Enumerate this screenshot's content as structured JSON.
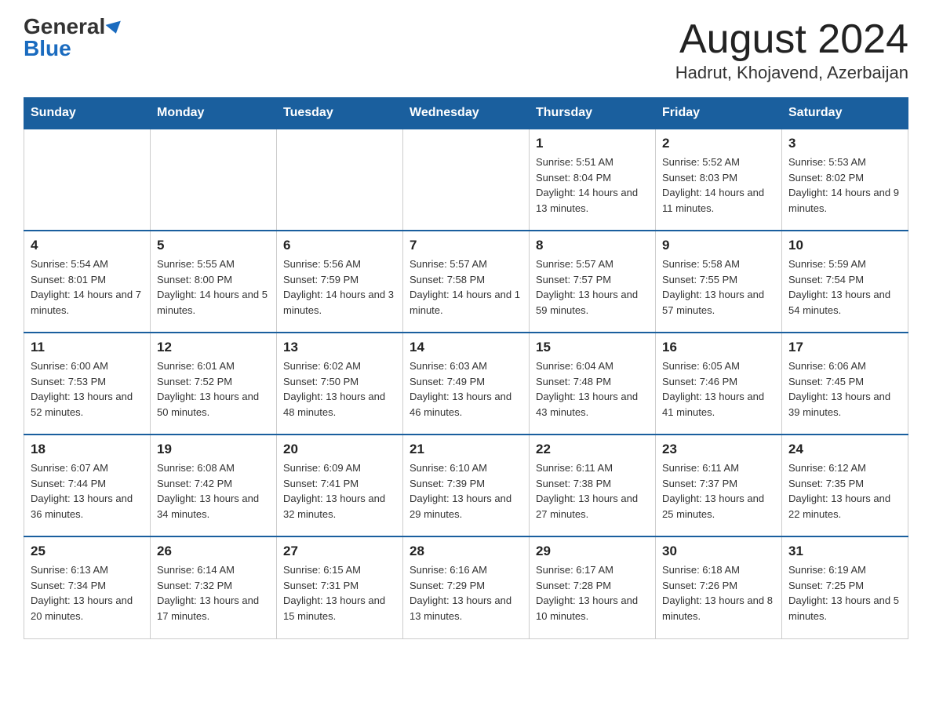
{
  "logo": {
    "general": "General",
    "blue": "Blue"
  },
  "header": {
    "month_year": "August 2024",
    "location": "Hadrut, Khojavend, Azerbaijan"
  },
  "days_of_week": [
    "Sunday",
    "Monday",
    "Tuesday",
    "Wednesday",
    "Thursday",
    "Friday",
    "Saturday"
  ],
  "weeks": [
    [
      {
        "day": "",
        "info": ""
      },
      {
        "day": "",
        "info": ""
      },
      {
        "day": "",
        "info": ""
      },
      {
        "day": "",
        "info": ""
      },
      {
        "day": "1",
        "info": "Sunrise: 5:51 AM\nSunset: 8:04 PM\nDaylight: 14 hours and 13 minutes."
      },
      {
        "day": "2",
        "info": "Sunrise: 5:52 AM\nSunset: 8:03 PM\nDaylight: 14 hours and 11 minutes."
      },
      {
        "day": "3",
        "info": "Sunrise: 5:53 AM\nSunset: 8:02 PM\nDaylight: 14 hours and 9 minutes."
      }
    ],
    [
      {
        "day": "4",
        "info": "Sunrise: 5:54 AM\nSunset: 8:01 PM\nDaylight: 14 hours and 7 minutes."
      },
      {
        "day": "5",
        "info": "Sunrise: 5:55 AM\nSunset: 8:00 PM\nDaylight: 14 hours and 5 minutes."
      },
      {
        "day": "6",
        "info": "Sunrise: 5:56 AM\nSunset: 7:59 PM\nDaylight: 14 hours and 3 minutes."
      },
      {
        "day": "7",
        "info": "Sunrise: 5:57 AM\nSunset: 7:58 PM\nDaylight: 14 hours and 1 minute."
      },
      {
        "day": "8",
        "info": "Sunrise: 5:57 AM\nSunset: 7:57 PM\nDaylight: 13 hours and 59 minutes."
      },
      {
        "day": "9",
        "info": "Sunrise: 5:58 AM\nSunset: 7:55 PM\nDaylight: 13 hours and 57 minutes."
      },
      {
        "day": "10",
        "info": "Sunrise: 5:59 AM\nSunset: 7:54 PM\nDaylight: 13 hours and 54 minutes."
      }
    ],
    [
      {
        "day": "11",
        "info": "Sunrise: 6:00 AM\nSunset: 7:53 PM\nDaylight: 13 hours and 52 minutes."
      },
      {
        "day": "12",
        "info": "Sunrise: 6:01 AM\nSunset: 7:52 PM\nDaylight: 13 hours and 50 minutes."
      },
      {
        "day": "13",
        "info": "Sunrise: 6:02 AM\nSunset: 7:50 PM\nDaylight: 13 hours and 48 minutes."
      },
      {
        "day": "14",
        "info": "Sunrise: 6:03 AM\nSunset: 7:49 PM\nDaylight: 13 hours and 46 minutes."
      },
      {
        "day": "15",
        "info": "Sunrise: 6:04 AM\nSunset: 7:48 PM\nDaylight: 13 hours and 43 minutes."
      },
      {
        "day": "16",
        "info": "Sunrise: 6:05 AM\nSunset: 7:46 PM\nDaylight: 13 hours and 41 minutes."
      },
      {
        "day": "17",
        "info": "Sunrise: 6:06 AM\nSunset: 7:45 PM\nDaylight: 13 hours and 39 minutes."
      }
    ],
    [
      {
        "day": "18",
        "info": "Sunrise: 6:07 AM\nSunset: 7:44 PM\nDaylight: 13 hours and 36 minutes."
      },
      {
        "day": "19",
        "info": "Sunrise: 6:08 AM\nSunset: 7:42 PM\nDaylight: 13 hours and 34 minutes."
      },
      {
        "day": "20",
        "info": "Sunrise: 6:09 AM\nSunset: 7:41 PM\nDaylight: 13 hours and 32 minutes."
      },
      {
        "day": "21",
        "info": "Sunrise: 6:10 AM\nSunset: 7:39 PM\nDaylight: 13 hours and 29 minutes."
      },
      {
        "day": "22",
        "info": "Sunrise: 6:11 AM\nSunset: 7:38 PM\nDaylight: 13 hours and 27 minutes."
      },
      {
        "day": "23",
        "info": "Sunrise: 6:11 AM\nSunset: 7:37 PM\nDaylight: 13 hours and 25 minutes."
      },
      {
        "day": "24",
        "info": "Sunrise: 6:12 AM\nSunset: 7:35 PM\nDaylight: 13 hours and 22 minutes."
      }
    ],
    [
      {
        "day": "25",
        "info": "Sunrise: 6:13 AM\nSunset: 7:34 PM\nDaylight: 13 hours and 20 minutes."
      },
      {
        "day": "26",
        "info": "Sunrise: 6:14 AM\nSunset: 7:32 PM\nDaylight: 13 hours and 17 minutes."
      },
      {
        "day": "27",
        "info": "Sunrise: 6:15 AM\nSunset: 7:31 PM\nDaylight: 13 hours and 15 minutes."
      },
      {
        "day": "28",
        "info": "Sunrise: 6:16 AM\nSunset: 7:29 PM\nDaylight: 13 hours and 13 minutes."
      },
      {
        "day": "29",
        "info": "Sunrise: 6:17 AM\nSunset: 7:28 PM\nDaylight: 13 hours and 10 minutes."
      },
      {
        "day": "30",
        "info": "Sunrise: 6:18 AM\nSunset: 7:26 PM\nDaylight: 13 hours and 8 minutes."
      },
      {
        "day": "31",
        "info": "Sunrise: 6:19 AM\nSunset: 7:25 PM\nDaylight: 13 hours and 5 minutes."
      }
    ]
  ]
}
